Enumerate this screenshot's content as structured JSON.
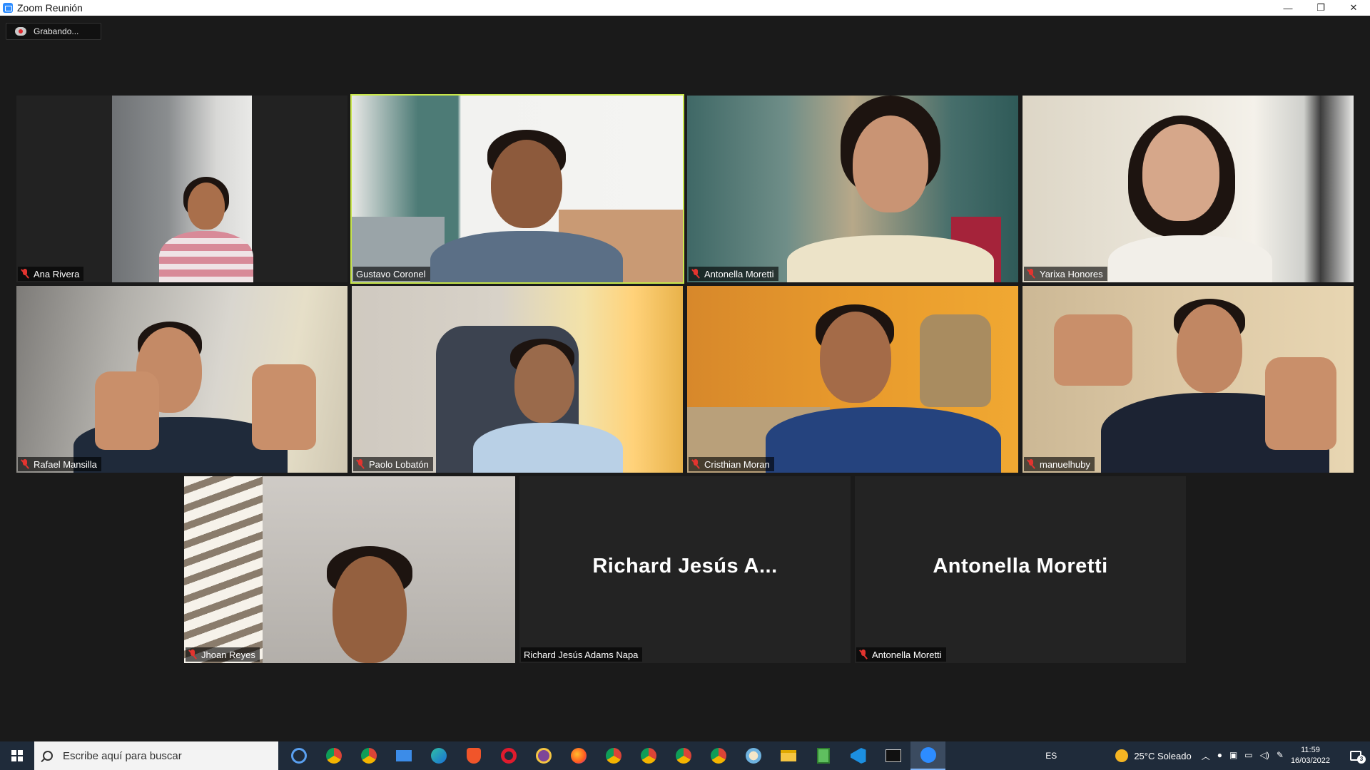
{
  "window": {
    "title": "Zoom Reunión",
    "minimize": "—",
    "restore": "❐",
    "close": "✕"
  },
  "recording": {
    "label": "Grabando..."
  },
  "participants": [
    {
      "name": "Ana Rivera",
      "muted": true
    },
    {
      "name": "Gustavo Coronel",
      "muted": false,
      "active_speaker": true
    },
    {
      "name": "Antonella Moretti",
      "muted": true
    },
    {
      "name": "Yarixa Honores",
      "muted": true
    },
    {
      "name": "Rafael Mansilla",
      "muted": true
    },
    {
      "name": "Paolo Lobatón",
      "muted": true
    },
    {
      "name": "Cristhian Moran",
      "muted": true
    },
    {
      "name": "manuelhuby",
      "muted": true
    },
    {
      "name": "Jhoan Reyes",
      "muted": true
    },
    {
      "name": "Richard Jesús Adams Napa",
      "display_name": "Richard  Jesús  A...",
      "muted": false,
      "video_off": true
    },
    {
      "name": "Antonella Moretti",
      "display_name": "Antonella Moretti",
      "muted": true,
      "video_off": true
    }
  ],
  "taskbar": {
    "search_placeholder": "Escribe aquí para buscar",
    "language": "ES",
    "weather": "25°C  Soleado",
    "time": "11:59",
    "date": "16/03/2022",
    "notifications": "3",
    "apps": [
      "cortana-icon",
      "chrome-icon",
      "chrome-icon",
      "mail-icon",
      "edge-icon",
      "brave-icon",
      "opera-icon",
      "tor-icon",
      "firefox-icon",
      "chrome-icon",
      "chrome-icon",
      "chrome-icon",
      "chrome-icon",
      "paint-icon",
      "file-explorer-icon",
      "notepad-icon",
      "vscode-icon",
      "terminal-icon",
      "zoom-icon"
    ]
  },
  "colors": {
    "active_speaker_border": "#c8e64a",
    "muted_icon": "#e3342f",
    "taskbar": "#1f2b3a"
  }
}
